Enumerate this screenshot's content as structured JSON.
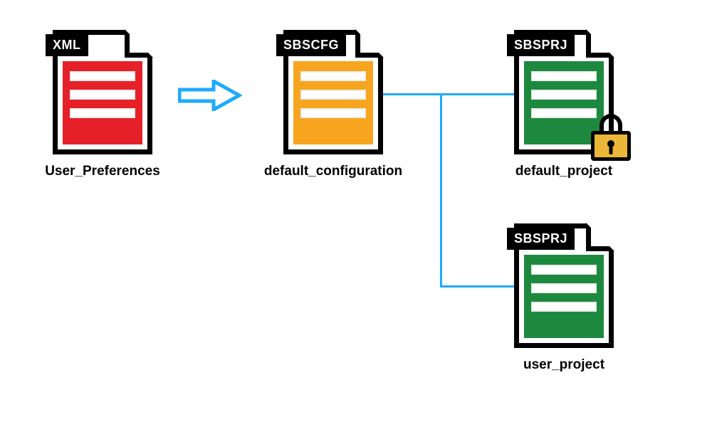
{
  "files": {
    "user_prefs": {
      "tag": "XML",
      "label": "User_Preferences",
      "fill": "#e62028"
    },
    "default_config": {
      "tag": "SBSCFG",
      "label": "default_configuration",
      "fill": "#f7a51e"
    },
    "default_project": {
      "tag": "SBSPRJ",
      "label": "default_project",
      "fill": "#1d893f",
      "locked": true
    },
    "user_project": {
      "tag": "SBSPRJ",
      "label": "user_project",
      "fill": "#1d893f"
    }
  },
  "colors": {
    "arrow_stroke": "#1eaafd",
    "connector": "#1eaafd",
    "lock_body": "#ebb739"
  },
  "layout_note": "XML User_Preferences → SBSCFG default_configuration — connected to SBSPRJ default_project (locked) and SBSPRJ user_project"
}
